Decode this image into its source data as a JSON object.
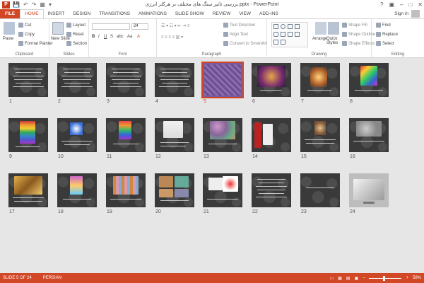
{
  "window": {
    "title": "بررسی تاثیر سنگ های مختلف بر هرکلر انرژی.pptx - PowerPoint",
    "app_icon": "P",
    "controls": [
      "?",
      "▣",
      "–",
      "□",
      "✕"
    ]
  },
  "quick_access": [
    "💾",
    "↶",
    "↷",
    "▦",
    "▾"
  ],
  "tabs": [
    "FILE",
    "HOME",
    "INSERT",
    "DESIGN",
    "TRANSITIONS",
    "ANIMATIONS",
    "SLIDE SHOW",
    "REVIEW",
    "VIEW",
    "ADD-INS"
  ],
  "active_tab": "HOME",
  "signin": "Sign in",
  "ribbon": {
    "clipboard": {
      "label": "Clipboard",
      "paste": "Paste",
      "cut": "Cut",
      "copy": "Copy",
      "format_painter": "Format Painter"
    },
    "slides": {
      "label": "Slides",
      "new_slide": "New Slide",
      "layout": "Layout",
      "reset": "Reset",
      "section": "Section"
    },
    "font": {
      "label": "Font",
      "font_size": "24",
      "bold": "B",
      "italic": "I",
      "underline": "U",
      "strike": "S",
      "abc": "abc",
      "aa": "Aa",
      "grow": "A",
      "shrink": "A"
    },
    "paragraph": {
      "label": "Paragraph",
      "text_direction": "Text Direction",
      "align_text": "Align Text",
      "smartart": "Convert to SmartArt"
    },
    "drawing": {
      "label": "Drawing",
      "arrange": "Arrange",
      "quick_styles": "Quick Styles",
      "shape_fill": "Shape Fill",
      "shape_outline": "Shape Outline",
      "shape_effects": "Shape Effects"
    },
    "editing": {
      "label": "Editing",
      "find": "Find",
      "replace": "Replace",
      "select": "Select"
    }
  },
  "slides": [
    {
      "num": "1"
    },
    {
      "num": "2"
    },
    {
      "num": "3"
    },
    {
      "num": "4"
    },
    {
      "num": "5"
    },
    {
      "num": "6"
    },
    {
      "num": "7"
    },
    {
      "num": "8"
    },
    {
      "num": "9"
    },
    {
      "num": "10"
    },
    {
      "num": "11"
    },
    {
      "num": "12"
    },
    {
      "num": "13"
    },
    {
      "num": "14"
    },
    {
      "num": "15"
    },
    {
      "num": "16"
    },
    {
      "num": "17"
    },
    {
      "num": "18"
    },
    {
      "num": "19"
    },
    {
      "num": "20"
    },
    {
      "num": "21"
    },
    {
      "num": "22"
    },
    {
      "num": "23"
    },
    {
      "num": "24"
    }
  ],
  "selected_slide": 5,
  "status": {
    "slide_counter": "SLIDE 5 OF 24",
    "language": "PERSIAN",
    "zoom": "58%",
    "zoom_minus": "–",
    "zoom_plus": "+"
  },
  "colors": {
    "accent": "#d24726",
    "ribbon_bg": "#ffffff",
    "sorter_bg": "#e6e6e6"
  }
}
